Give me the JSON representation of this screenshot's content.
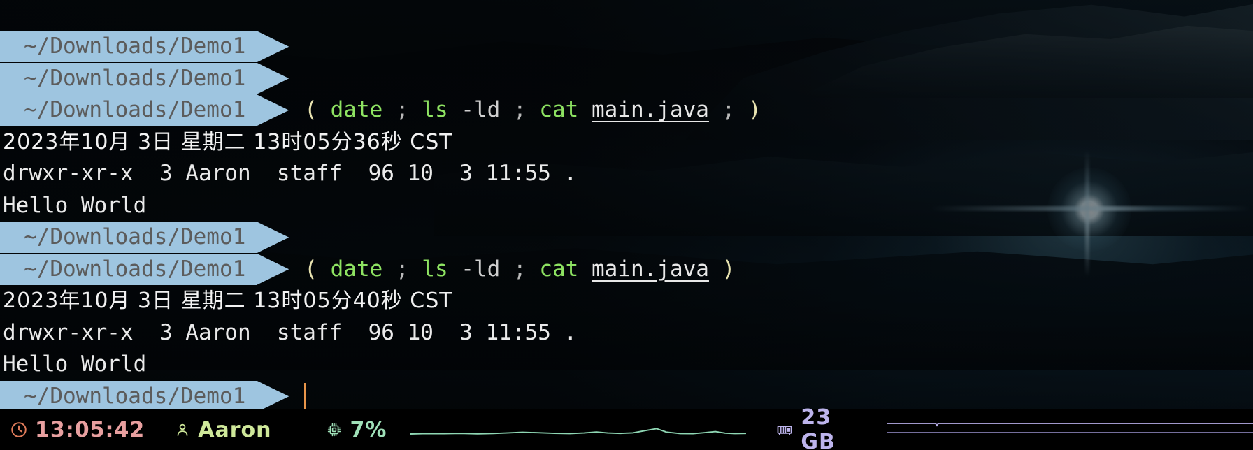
{
  "terminal": {
    "prompt_path": "~/Downloads/Demo1",
    "lines": [
      {
        "kind": "prompt_only",
        "path": "~/Downloads/Demo1"
      },
      {
        "kind": "prompt_only",
        "path": "~/Downloads/Demo1"
      },
      {
        "kind": "prompt_cmd",
        "path": "~/Downloads/Demo1",
        "tokens": [
          {
            "t": "(",
            "c": "paren"
          },
          {
            "t": "date",
            "c": "cmd"
          },
          {
            "t": ";",
            "c": "semi"
          },
          {
            "t": "ls",
            "c": "cmd"
          },
          {
            "t": "-ld",
            "c": "arg"
          },
          {
            "t": ";",
            "c": "semi"
          },
          {
            "t": "cat",
            "c": "cmd"
          },
          {
            "t": "main.java",
            "c": "file"
          },
          {
            "t": ";",
            "c": "semi"
          },
          {
            "t": ")",
            "c": "paren"
          }
        ]
      },
      {
        "kind": "output_cn",
        "text": "2023年10月 3日 星期二 13时05分36秒 CST"
      },
      {
        "kind": "output",
        "text": "drwxr-xr-x  3 Aaron  staff  96 10  3 11:55 ."
      },
      {
        "kind": "output",
        "text": "Hello World"
      },
      {
        "kind": "prompt_only",
        "path": "~/Downloads/Demo1"
      },
      {
        "kind": "prompt_cmd",
        "path": "~/Downloads/Demo1",
        "tokens": [
          {
            "t": "(",
            "c": "paren"
          },
          {
            "t": "date",
            "c": "cmd"
          },
          {
            "t": ";",
            "c": "semi"
          },
          {
            "t": "ls",
            "c": "cmd"
          },
          {
            "t": "-ld",
            "c": "arg"
          },
          {
            "t": ";",
            "c": "semi"
          },
          {
            "t": "cat",
            "c": "cmd"
          },
          {
            "t": "main.java",
            "c": "file"
          },
          {
            "t": ")",
            "c": "paren"
          }
        ]
      },
      {
        "kind": "output_cn",
        "text": "2023年10月 3日 星期二 13时05分40秒 CST"
      },
      {
        "kind": "output",
        "text": "drwxr-xr-x  3 Aaron  staff  96 10  3 11:55 ."
      },
      {
        "kind": "output",
        "text": "Hello World"
      },
      {
        "kind": "prompt_cursor",
        "path": "~/Downloads/Demo1"
      }
    ],
    "colors": {
      "prompt_bg": "#9ec5e0",
      "prompt_fg": "#5c5c5c",
      "command": "#8ee362",
      "paren": "#e8e3b0",
      "argument": "#cfcfcf",
      "output": "#eaeaea",
      "cursor": "#e8954a"
    }
  },
  "status_bar": {
    "clock": {
      "icon": "clock-icon",
      "value": "13:05:42",
      "color": "#e8a0a0"
    },
    "user": {
      "icon": "user-icon",
      "value": "Aaron",
      "color": "#cfe89a"
    },
    "cpu": {
      "icon": "cpu-chip-icon",
      "value": "7%",
      "color": "#9fe0b8"
    },
    "memory": {
      "icon": "memory-ram-icon",
      "value": "23 GB",
      "color": "#bdb4ec"
    }
  }
}
